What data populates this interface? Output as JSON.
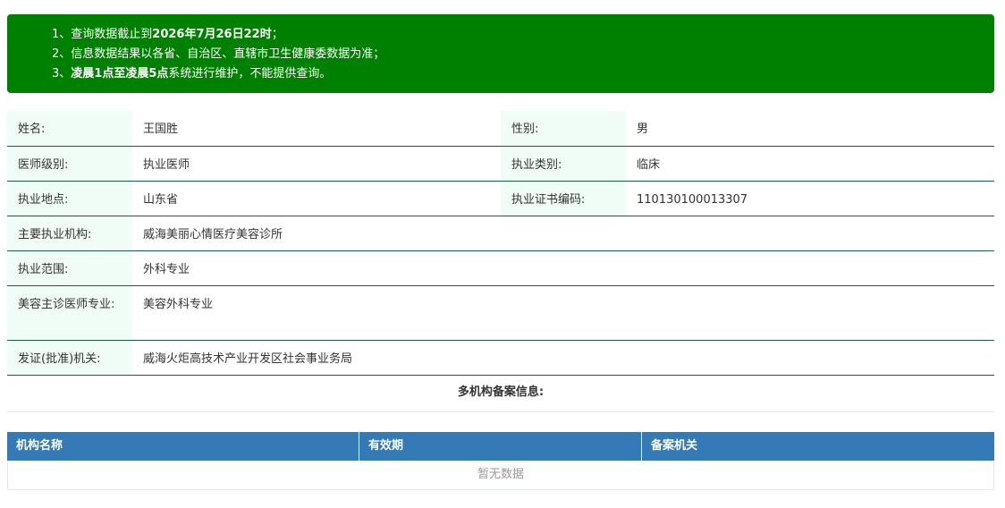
{
  "notice": {
    "line1_prefix": "1、查询数据截止到",
    "line1_bold": "2026年7月26日22时",
    "line1_suffix": "；",
    "line2": "2、信息数据结果以各省、自治区、直辖市卫生健康委数据为准；",
    "line3_prefix": "3、",
    "line3_bold": "凌晨1点至凌晨5点",
    "line3_suffix": "系统进行维护，不能提供查询。"
  },
  "info": {
    "name_label": "姓名:",
    "name_value": "王国胜",
    "gender_label": "性别:",
    "gender_value": "男",
    "level_label": "医师级别:",
    "level_value": "执业医师",
    "category_label": "执业类别:",
    "category_value": "临床",
    "location_label": "执业地点:",
    "location_value": "山东省",
    "cert_label": "执业证书编码:",
    "cert_value": "110130100013307",
    "org_label": "主要执业机构:",
    "org_value": "威海美丽心情医疗美容诊所",
    "scope_label": "执业范围:",
    "scope_value": "外科专业",
    "cosmetic_label": "美容主诊医师专业:",
    "cosmetic_value": "美容外科专业",
    "issuer_label": "发证(批准)机关:",
    "issuer_value": "威海火炬高技术产业开发区社会事业务局"
  },
  "multi_org": {
    "title": "多机构备案信息:",
    "columns": [
      "机构名称",
      "有效期",
      "备案机关"
    ],
    "empty_text": "暂无数据"
  },
  "colors": {
    "notice_bg": "#008000",
    "label_bg": "#f0fcf6",
    "row_border": "#1e5b46",
    "table_header_bg": "#337ab7"
  }
}
